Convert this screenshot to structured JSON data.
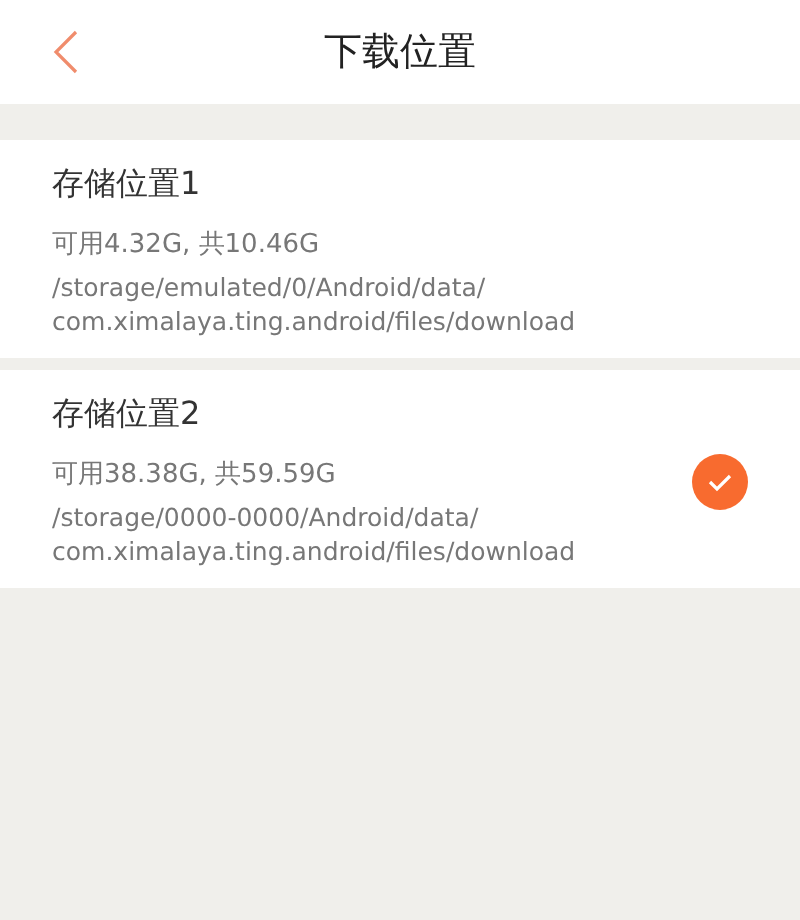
{
  "header": {
    "title": "下载位置"
  },
  "locations": [
    {
      "name": "存储位置1",
      "capacity": "可用4.32G, 共10.46G",
      "path_lines": [
        "/storage/emulated/0/Android/data/",
        "com.ximalaya.ting.android/files/download"
      ],
      "selected": false
    },
    {
      "name": "存储位置2",
      "capacity": "可用38.38G, 共59.59G",
      "path_lines": [
        "/storage/0000-0000/Android/data/",
        "com.ximalaya.ting.android/files/download"
      ],
      "selected": true
    }
  ]
}
